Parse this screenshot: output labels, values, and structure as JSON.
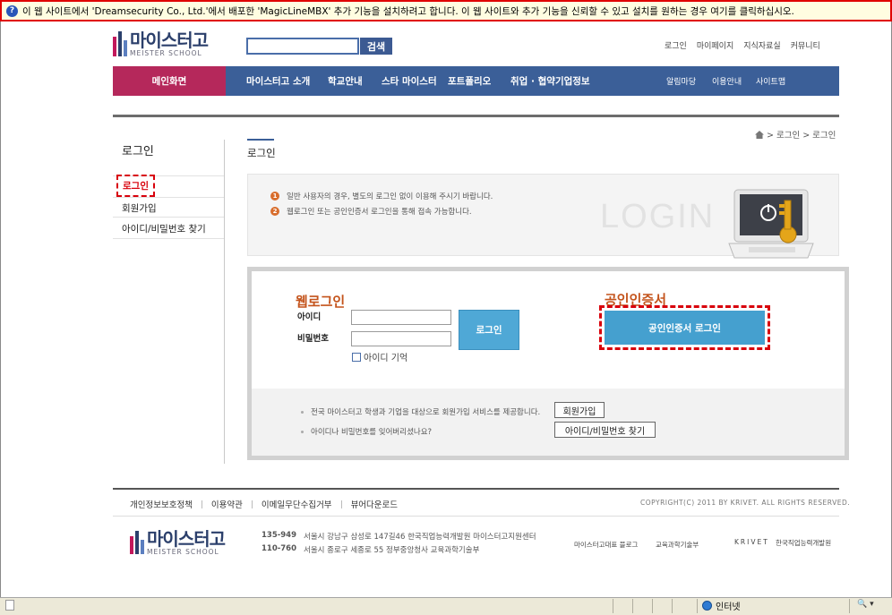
{
  "infobar": {
    "icon": "info-icon",
    "message": "이 웹 사이트에서 'Dreamsecurity Co., Ltd.'에서 배포한 'MagicLineMBX' 추가 기능을 설치하려고 합니다. 이 웹 사이트와 추가 기능을 신뢰할 수 있고 설치를 원하는 경우 여기를 클릭하십시오."
  },
  "logo": {
    "ko": "마이스터고",
    "en": "MEISTER SCHOOL"
  },
  "search": {
    "button": "검색",
    "value": ""
  },
  "util_links": [
    "로그인",
    "마이페이지",
    "지식자료실",
    "커뮤니티"
  ],
  "gnb": {
    "main": "메인화면",
    "items": [
      "마이스터고 소개",
      "학교안내",
      "스타 마이스터",
      "포트폴리오",
      "취업 · 협약기업정보"
    ],
    "sub": [
      "알림마당",
      "이용안내",
      "사이트맵"
    ]
  },
  "lnb": {
    "title": "로그인",
    "items": [
      "로그인",
      "회원가입",
      "아이디/비밀번호 찾기"
    ]
  },
  "breadcrumb": {
    "home_icon": "home-icon",
    "items": [
      "> 로그인",
      "> 로그인"
    ]
  },
  "content": {
    "title": "로그인",
    "notices": [
      {
        "num": "1",
        "text": "일반 사용자의 경우, 별도의 로그인 없이 이용해 주시기 바랍니다."
      },
      {
        "num": "2",
        "text": "웹로그인 또는 공인인증서 로그인을 통해 접속 가능합니다."
      }
    ],
    "watermark": "LOGIN",
    "illustration": "laptop-key-icon"
  },
  "login": {
    "web_title": "웹로그인",
    "id_label": "아이디",
    "pw_label": "비밀번호",
    "id_value": "",
    "pw_value": "",
    "login_button": "로그인",
    "remember_label": "아이디 기억",
    "cert_title": "공인인증서",
    "cert_button": "공인인증서 로그인",
    "join_text": "전국 마이스터고 학생과 기업을 대상으로 회원가입 서비스를 제공합니다.",
    "join_button": "회원가입",
    "find_text": "아이디나 비밀번호를 잊어버리셨나요?",
    "find_button": "아이디/비밀번호 찾기"
  },
  "footer": {
    "links": [
      "개인정보보호정책",
      "이용약관",
      "이메일무단수집거부",
      "뷰어다운로드"
    ],
    "copyright": "COPYRIGHT(C) 2011 BY KRIVET. ALL RIGHTS RESERVED.",
    "addresses": [
      {
        "zip": "135-949",
        "addr": "서울시 강남구 삼성로 147길46 한국직업능력개발원 마이스터고지원센터"
      },
      {
        "zip": "110-760",
        "addr": "서울시 종로구 세종로 55 정부중앙청사 교육과학기술부"
      }
    ],
    "partners": [
      "마이스터고대표 블로그",
      "교육과학기술부",
      "KRIVET",
      "한국직업능력개발원"
    ]
  },
  "statusbar": {
    "zone": "인터넷",
    "zoom": "🔍 ▾",
    "zone_icon": "globe-icon"
  },
  "colors": {
    "gnb": "#3b5f98",
    "main_menu": "#b5285b",
    "highlight": "#d8000b",
    "accent_orange": "#c4541c",
    "button_blue": "#4fa8d6"
  }
}
